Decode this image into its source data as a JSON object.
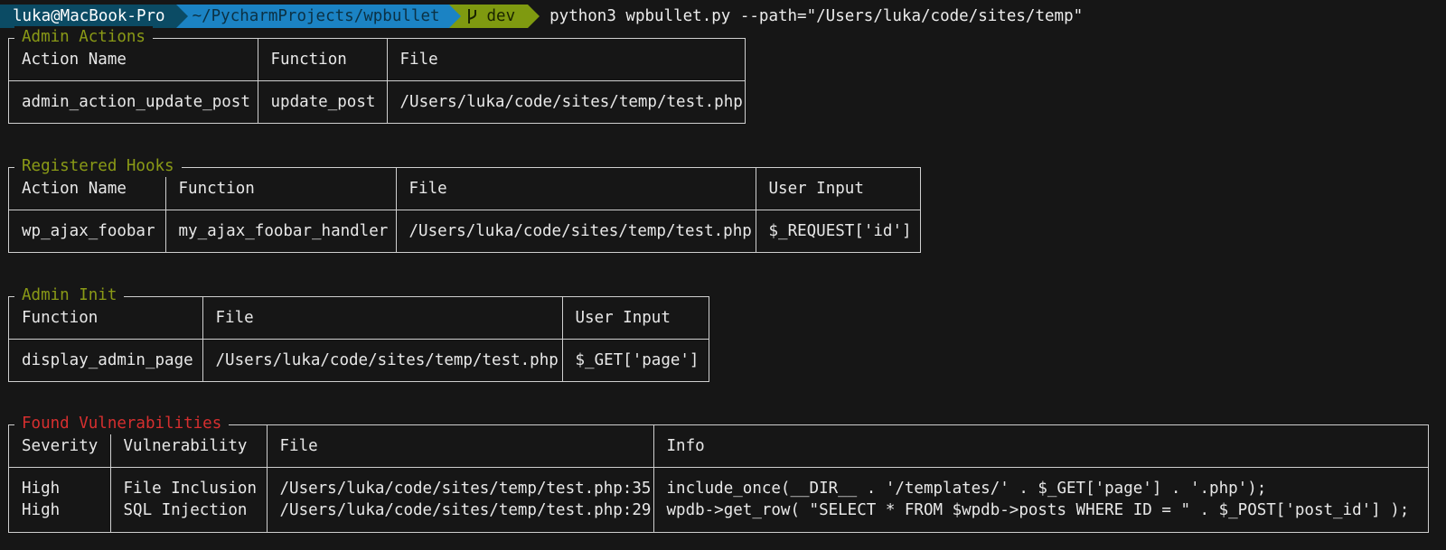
{
  "prompt": {
    "user_host": "luka@MacBook-Pro",
    "path": "~/PycharmProjects/wpbullet",
    "branch": "dev",
    "command": "python3 wpbullet.py --path=\"/Users/luka/code/sites/temp\""
  },
  "colors": {
    "segment_user": "#0b4b64",
    "segment_path": "#1b83c4",
    "segment_branch": "#7f9a10",
    "title_green": "#8a9a16",
    "title_red": "#d62f2f"
  },
  "admin_actions": {
    "title": "Admin Actions",
    "headers": [
      "Action Name",
      "Function",
      "File"
    ],
    "rows": [
      [
        "admin_action_update_post",
        "update_post",
        "/Users/luka/code/sites/temp/test.php"
      ]
    ]
  },
  "registered_hooks": {
    "title": "Registered Hooks",
    "headers": [
      "Action Name",
      "Function",
      "File",
      "User Input"
    ],
    "rows": [
      [
        "wp_ajax_foobar",
        "my_ajax_foobar_handler",
        "/Users/luka/code/sites/temp/test.php",
        "$_REQUEST['id']"
      ]
    ]
  },
  "admin_init": {
    "title": "Admin Init",
    "headers": [
      "Function",
      "File",
      "User Input"
    ],
    "rows": [
      [
        "display_admin_page",
        "/Users/luka/code/sites/temp/test.php",
        "$_GET['page']"
      ]
    ]
  },
  "found_vulnerabilities": {
    "title": "Found Vulnerabilities",
    "headers": [
      "Severity",
      "Vulnerability",
      "File",
      "Info"
    ],
    "rows": [
      [
        "High",
        "File Inclusion",
        "/Users/luka/code/sites/temp/test.php:35",
        "include_once(__DIR__ . '/templates/' . $_GET['page'] . '.php');"
      ],
      [
        "High",
        "SQL Injection",
        "/Users/luka/code/sites/temp/test.php:29",
        "wpdb->get_row( \"SELECT * FROM $wpdb->posts WHERE ID = \" . $_POST['post_id'] );"
      ]
    ]
  }
}
